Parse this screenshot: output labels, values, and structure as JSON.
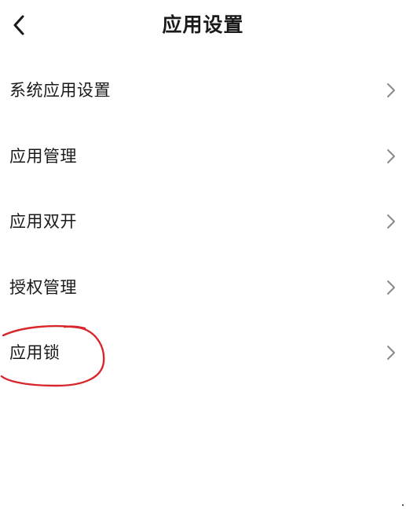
{
  "header": {
    "title": "应用设置",
    "back_icon": "chevron-left-icon"
  },
  "menu": {
    "items": [
      {
        "label": "系统应用设置",
        "icon": "chevron-right-icon"
      },
      {
        "label": "应用管理",
        "icon": "chevron-right-icon"
      },
      {
        "label": "应用双开",
        "icon": "chevron-right-icon"
      },
      {
        "label": "授权管理",
        "icon": "chevron-right-icon"
      },
      {
        "label": "应用锁",
        "icon": "chevron-right-icon"
      }
    ]
  },
  "colors": {
    "text": "#1a1a1a",
    "chevron": "#8a8a8a",
    "annotation_ink": "#d9262c",
    "background": "#ffffff"
  }
}
